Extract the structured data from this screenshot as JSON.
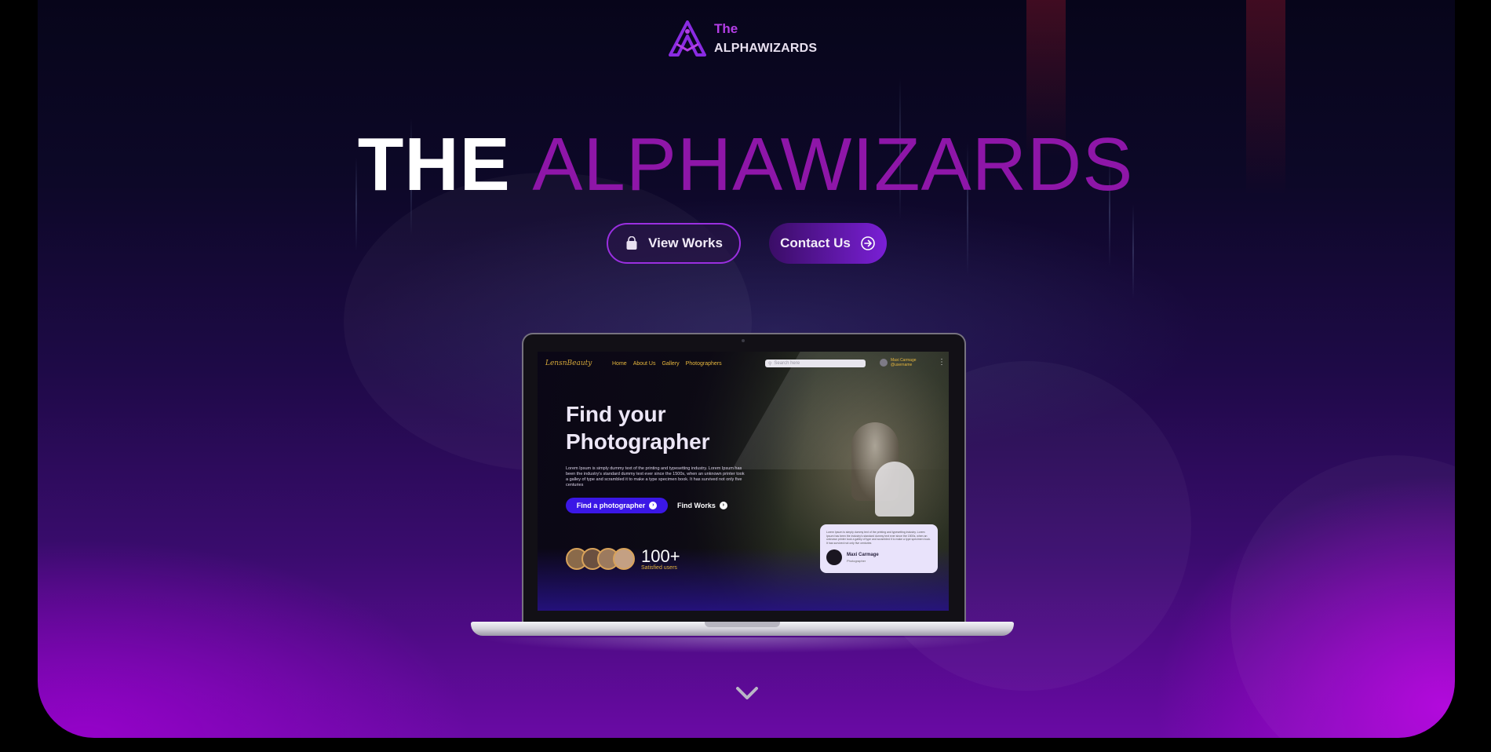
{
  "brand": {
    "logo_line1": "The",
    "logo_line2": "ALPHAWIZARDS",
    "logo_icon": "alphawizards-logo-icon",
    "accent_color": "#b43ee6"
  },
  "hero": {
    "title_word1": "THE",
    "title_word2": "ALPHAWIZARDS",
    "title_accent_color": "#8e16a8"
  },
  "buttons": {
    "view_works": {
      "label": "View Works",
      "icon": "shopping-bag-icon"
    },
    "contact_us": {
      "label": "Contact Us",
      "icon": "arrow-circle-right-icon"
    }
  },
  "mockup": {
    "logo": "LensnBeauty",
    "nav": [
      "Home",
      "About Us",
      "Gallery",
      "Photographers"
    ],
    "search_placeholder": "Search here",
    "user_name": "Maxi Carmage",
    "user_handle": "@username",
    "headline_line1": "Find your",
    "headline_line2": "Photographer",
    "paragraph": "Lorem Ipsum is simply dummy text of the printing and typesetting industry. Lorem Ipsum has been the industry's standard dummy text ever since the 1500s, when an unknown printer took a galley of type and scrambled it to make a type specimen book. It has survived not only five centuries",
    "primary_button": "Find a photographer",
    "secondary_button": "Find Works",
    "stat_value": "100+",
    "stat_label": "Satisfied users",
    "review_text": "Lorem Ipsum is simply dummy text of the printing and typesetting industry. Lorem Ipsum has been the industry's standard dummy text ever since the 1500s, when an unknown printer took a galley of type and scrambled it to make a type specimen book. It has survived not only five centuries",
    "review_name": "Maxi Carmage",
    "review_role": "Photographer"
  },
  "scroll_indicator": {
    "icon": "chevron-down-icon"
  }
}
